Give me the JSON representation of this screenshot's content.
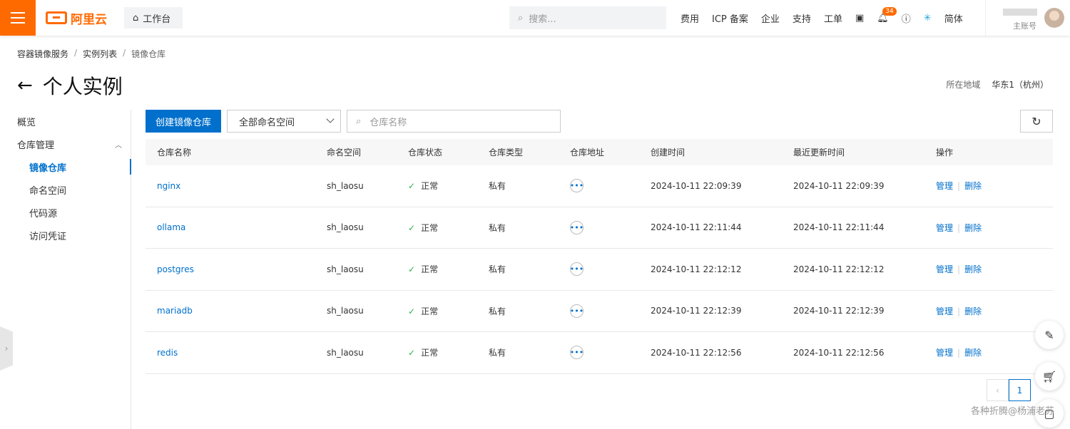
{
  "topbar": {
    "logo_text": "阿里云",
    "workbench_label": "工作台",
    "search_placeholder": "搜索...",
    "nav_items": [
      "费用",
      "ICP 备案",
      "企业",
      "支持",
      "工单"
    ],
    "notification_count": "34",
    "language": "简体",
    "account_role": "主账号",
    "accent_color": "#ff6a00"
  },
  "breadcrumb": [
    "容器镜像服务",
    "实例列表",
    "镜像仓库"
  ],
  "page": {
    "title": "个人实例",
    "region_label": "所在地域",
    "region_value": "华东1（杭州）"
  },
  "sidebar": {
    "overview": "概览",
    "repo_mgmt": "仓库管理",
    "items": [
      "镜像仓库",
      "命名空间",
      "代码源",
      "访问凭证"
    ]
  },
  "toolbar": {
    "create_label": "创建镜像仓库",
    "namespace_select": "全部命名空间",
    "filter_placeholder": "仓库名称"
  },
  "table": {
    "headers": [
      "仓库名称",
      "命名空间",
      "仓库状态",
      "仓库类型",
      "仓库地址",
      "创建时间",
      "最近更新时间",
      "操作"
    ],
    "rows": [
      {
        "name": "nginx",
        "namespace": "sh_laosu",
        "status": "正常",
        "type": "私有",
        "created": "2024-10-11 22:09:39",
        "updated": "2024-10-11 22:09:39"
      },
      {
        "name": "ollama",
        "namespace": "sh_laosu",
        "status": "正常",
        "type": "私有",
        "created": "2024-10-11 22:11:44",
        "updated": "2024-10-11 22:11:44"
      },
      {
        "name": "postgres",
        "namespace": "sh_laosu",
        "status": "正常",
        "type": "私有",
        "created": "2024-10-11 22:12:12",
        "updated": "2024-10-11 22:12:12"
      },
      {
        "name": "mariadb",
        "namespace": "sh_laosu",
        "status": "正常",
        "type": "私有",
        "created": "2024-10-11 22:12:39",
        "updated": "2024-10-11 22:12:39"
      },
      {
        "name": "redis",
        "namespace": "sh_laosu",
        "status": "正常",
        "type": "私有",
        "created": "2024-10-11 22:12:56",
        "updated": "2024-10-11 22:12:56"
      }
    ],
    "manage_label": "管理",
    "delete_label": "删除"
  },
  "pagination": {
    "current": "1"
  },
  "watermark": "各种折腾@杨浦老苏",
  "primary_color": "#0070cc"
}
